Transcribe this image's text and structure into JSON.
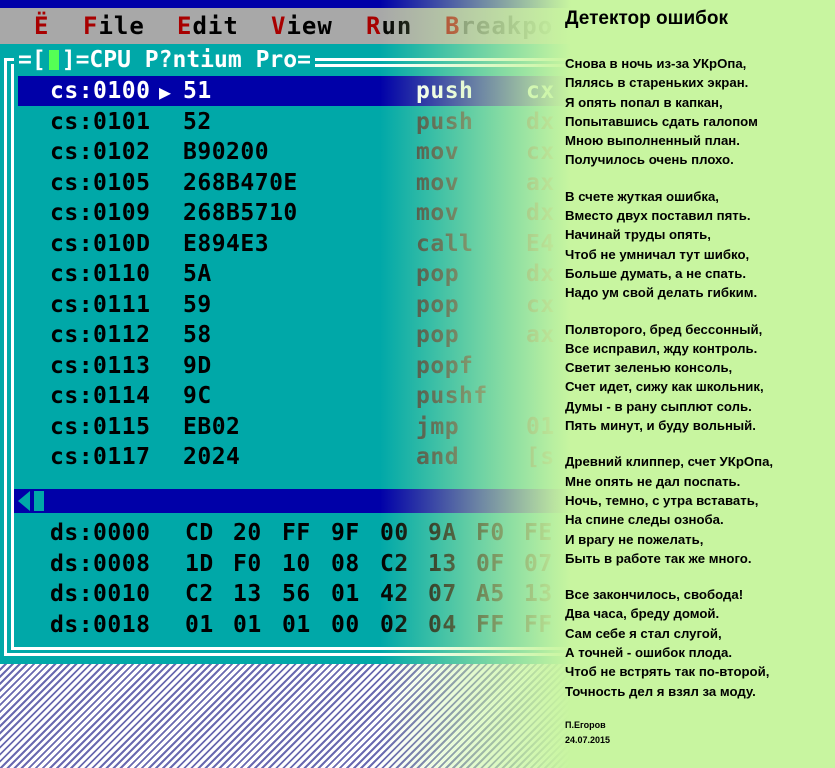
{
  "debugger": {
    "menu": [
      {
        "id": "system",
        "hot": "Ё",
        "rest": ""
      },
      {
        "id": "file",
        "hot": "F",
        "rest": "ile"
      },
      {
        "id": "edit",
        "hot": "E",
        "rest": "dit"
      },
      {
        "id": "view",
        "hot": "V",
        "rest": "iew"
      },
      {
        "id": "run",
        "hot": "R",
        "rest": "un"
      },
      {
        "id": "breakpoints",
        "hot": "B",
        "rest": "reakpo"
      }
    ],
    "cpu_title": "=CPU P?ntium Pro=",
    "cpu_title_left": "=[",
    "cpu_title_right": "]",
    "code": [
      {
        "addr": "cs:0100",
        "bytes": "51",
        "mnem": "push",
        "oper": "cx",
        "selected": true
      },
      {
        "addr": "cs:0101",
        "bytes": "52",
        "mnem": "push",
        "oper": "dx"
      },
      {
        "addr": "cs:0102",
        "bytes": "B90200",
        "mnem": "mov",
        "oper": "cx"
      },
      {
        "addr": "cs:0105",
        "bytes": "268B470E",
        "mnem": "mov",
        "oper": "ax"
      },
      {
        "addr": "cs:0109",
        "bytes": "268B5710",
        "mnem": "mov",
        "oper": "dx"
      },
      {
        "addr": "cs:010D",
        "bytes": "E894E3",
        "mnem": "call",
        "oper": "E4"
      },
      {
        "addr": "cs:0110",
        "bytes": "5A",
        "mnem": "pop",
        "oper": "dx"
      },
      {
        "addr": "cs:0111",
        "bytes": "59",
        "mnem": "pop",
        "oper": "cx"
      },
      {
        "addr": "cs:0112",
        "bytes": "58",
        "mnem": "pop",
        "oper": "ax"
      },
      {
        "addr": "cs:0113",
        "bytes": "9D",
        "mnem": "popf",
        "oper": ""
      },
      {
        "addr": "cs:0114",
        "bytes": "9C",
        "mnem": "pushf",
        "oper": ""
      },
      {
        "addr": "cs:0115",
        "bytes": "EB02",
        "mnem": "jmp",
        "oper": "01"
      },
      {
        "addr": "cs:0117",
        "bytes": "2024",
        "mnem": "and",
        "oper": "[s"
      }
    ],
    "dump": [
      {
        "addr": "ds:0000",
        "bytes": [
          "CD",
          "20",
          "FF",
          "9F",
          "00",
          "9A",
          "F0",
          "FE"
        ]
      },
      {
        "addr": "ds:0008",
        "bytes": [
          "1D",
          "F0",
          "10",
          "08",
          "C2",
          "13",
          "0F",
          "07"
        ]
      },
      {
        "addr": "ds:0010",
        "bytes": [
          "C2",
          "13",
          "56",
          "01",
          "42",
          "07",
          "A5",
          "13"
        ]
      },
      {
        "addr": "ds:0018",
        "bytes": [
          "01",
          "01",
          "01",
          "00",
          "02",
          "04",
          "FF",
          "FF"
        ]
      }
    ]
  },
  "poem": {
    "title": "Детектор ошибок",
    "stanzas": [
      [
        "Снова в ночь из-за УКрОпа,",
        "Пялясь в стареньких экран.",
        "Я опять попал в капкан,",
        "Попытавшись сдать галопом",
        "Мною выполненный план.",
        "Получилось очень плохо."
      ],
      [
        "В счете жуткая ошибка,",
        "Вместо двух поставил пять.",
        "Начинай труды опять,",
        "Чтоб не умничал тут шибко,",
        "Больше думать, а не спать.",
        "Надо ум свой делать гибким."
      ],
      [
        "Полвторого, бред бессонный,",
        "Все исправил, жду контроль.",
        "Светит зеленью консоль,",
        "Счет идет, сижу как школьник,",
        "Думы - в рану сыплют соль.",
        "Пять минут, и буду вольный."
      ],
      [
        "Древний клиппер, счет УКрОпа,",
        "Мне опять не дал поспать.",
        "Ночь, темно, с утра вставать,",
        "На спине следы озноба.",
        "И врагу не пожелать,",
        "Быть в работе так же много."
      ],
      [
        "Все закончилось, свобода!",
        "Два часа, бреду домой.",
        "Сам себе я стал слугой,",
        "А точней - ошибок плода.",
        "Чтоб не встрять так по-второй,",
        "Точность дел я взял за моду."
      ]
    ],
    "author": "П.Егоров",
    "date": "24.07.2015"
  }
}
